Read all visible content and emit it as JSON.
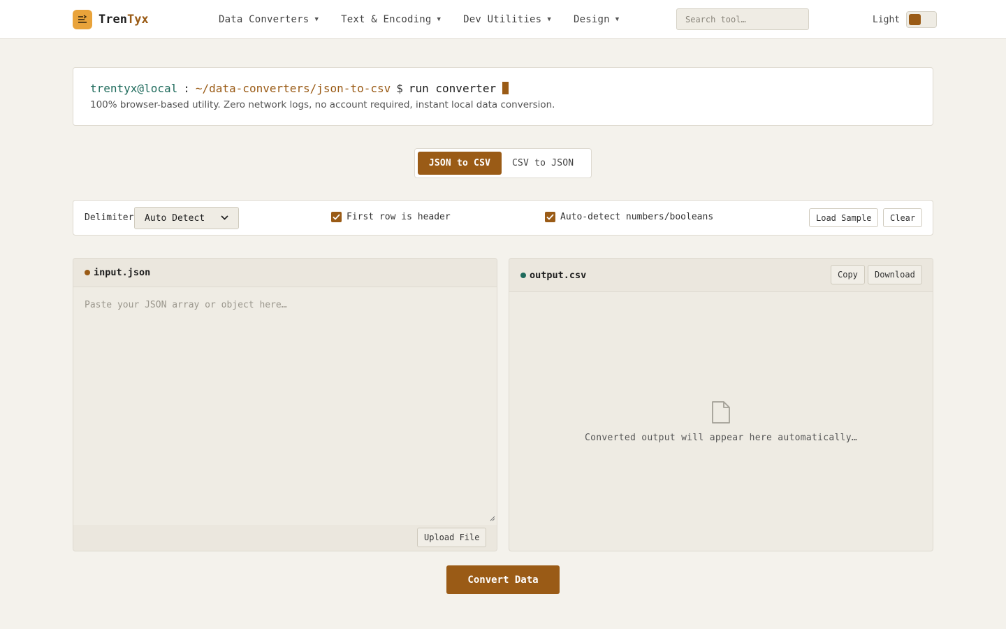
{
  "header": {
    "logo": {
      "part1": "Tren",
      "part2": "Tyx",
      "icon": "lines-arrow-icon"
    },
    "nav": [
      {
        "label": "Data Converters"
      },
      {
        "label": "Text & Encoding"
      },
      {
        "label": "Dev Utilities"
      },
      {
        "label": "Design"
      }
    ],
    "search_placeholder": "Search tool…",
    "theme_label": "Light"
  },
  "terminal": {
    "user": "trentyx@local",
    "separator": ":",
    "path": "~/data-converters/json-to-csv",
    "prompt": "$",
    "command": "run converter",
    "description": "100% browser-based utility. Zero network logs, no account required, instant local data conversion."
  },
  "modes": {
    "active": "JSON to CSV",
    "inactive": "CSV to JSON"
  },
  "options": {
    "delimiter_label": "Delimiter",
    "delimiter_value": "Auto Detect",
    "first_row_header": "First row is header",
    "auto_detect": "Auto-detect numbers/booleans",
    "load_sample": "Load Sample",
    "clear": "Clear"
  },
  "input_panel": {
    "title": "input.json",
    "placeholder": "Paste your JSON array or object here…",
    "upload": "Upload File"
  },
  "output_panel": {
    "title": "output.csv",
    "copy": "Copy",
    "download": "Download",
    "empty_text": "Converted output will appear here automatically…"
  },
  "convert_label": "Convert Data",
  "colors": {
    "accent": "#9a5b16",
    "logo": "#e9a33a",
    "teal": "#1f6b5c"
  }
}
